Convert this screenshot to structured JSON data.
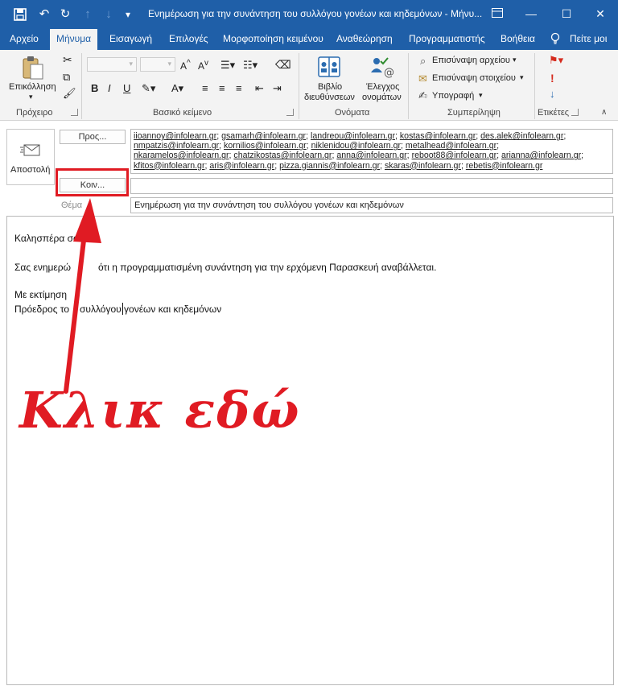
{
  "window": {
    "title": "Ενημέρωση για την συνάντηση του συλλόγου γονέων και κηδεμόνων  -  Μήνυ..."
  },
  "tabs": [
    "Αρχείο",
    "Μήνυμα",
    "Εισαγωγή",
    "Επιλογές",
    "Μορφοποίηση κειμένου",
    "Αναθεώρηση",
    "Προγραμματιστής",
    "Βοήθεια"
  ],
  "tell_me": "Πείτε μοι",
  "ribbon": {
    "paste": "Επικόλληση",
    "clipboard": "Πρόχειρο",
    "basic_text": "Βασικό κείμενο",
    "address_book_1": "Βιβλίο",
    "address_book_2": "διευθύνσεων",
    "check_names_1": "Έλεγχος",
    "check_names_2": "ονομάτων",
    "names": "Ονόματα",
    "attach_file": "Επισύναψη αρχείου",
    "attach_item": "Επισύναψη στοιχείου",
    "signature": "Υπογραφή",
    "include": "Συμπερίληψη",
    "tags": "Ετικέτες"
  },
  "compose": {
    "send": "Αποστολή",
    "to_button": "Προς...",
    "cc_button": "Κοιν...",
    "subject_label": "Θέμα",
    "subject": "Ενημέρωση για την συνάντηση του συλλόγου γονέων και κηδεμόνων",
    "cc_value": ""
  },
  "recipients": [
    [
      "iioannoy@infolearn.gr",
      "gsamarh@infolearn.gr",
      "landreou@infolearn.gr",
      "kostas@infolearn.gr",
      "des.alek@infolearn.gr"
    ],
    [
      "nmpatzis@infolearn.gr",
      "kornilios@infolearn.gr",
      "niklenidou@infolearn.gr",
      "metalhead@infolearn.gr"
    ],
    [
      "nkaramelos@infolearn.gr",
      "chatzikostas@infolearn.gr",
      "anna@infolearn.gr",
      "reboot88@infolearn.gr",
      "arianna@infolearn.gr"
    ],
    [
      "kfitos@infolearn.gr",
      "aris@infolearn.gr",
      "pizza.giannis@infolearn.gr",
      "skaras@infolearn.gr",
      "rebetis@infolearn.gr"
    ]
  ],
  "body": {
    "greeting": "Καλησπέρα σα",
    "line1_a": "Σας ενημερώ",
    "line1_b": "ότι η προγραμματισμένη συνάντηση για την ερχόμενη Παρασκευή αναβάλλεται.",
    "regards": "Με εκτίμηση",
    "sig_a": "Πρόεδρος το",
    "sig_b": "συλλόγου γονέων και κηδεμόνων"
  },
  "annotation": "Κλικ εδώ",
  "colors": {
    "titlebar": "#1f5fa8",
    "annotation": "#e01b23"
  }
}
